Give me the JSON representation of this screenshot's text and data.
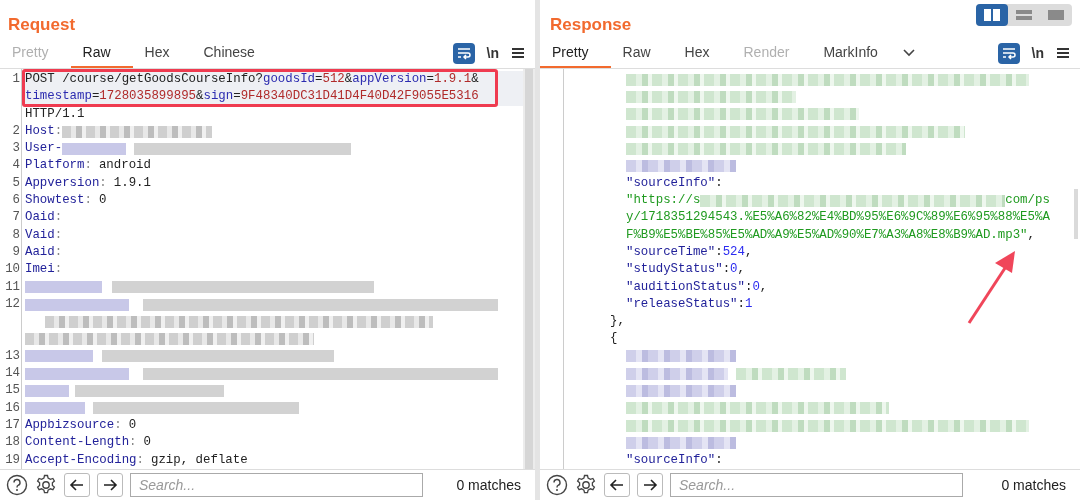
{
  "request": {
    "title": "Request",
    "tabs": [
      {
        "label": "Pretty",
        "selected": false,
        "disabled": true
      },
      {
        "label": "Raw",
        "selected": true,
        "disabled": false
      },
      {
        "label": "Hex",
        "selected": false,
        "disabled": false
      },
      {
        "label": "Chinese",
        "selected": false,
        "disabled": false
      }
    ],
    "toolbar": {
      "wrap_on": true,
      "newline_label": "\\n"
    },
    "lines": [
      {
        "number": "1",
        "kind": "request",
        "highlighted": true,
        "rows": [
          {
            "segments": [
              {
                "kind": "plain",
                "text": "POST /course/getGoodsCourseInfo?"
              },
              {
                "kind": "key",
                "text": "goodsId"
              },
              {
                "kind": "plain",
                "text": "="
              },
              {
                "kind": "value",
                "text": "512"
              },
              {
                "kind": "plain",
                "text": "&"
              },
              {
                "kind": "key",
                "text": "appVersion"
              },
              {
                "kind": "plain",
                "text": "="
              },
              {
                "kind": "value",
                "text": "1.9.1"
              },
              {
                "kind": "plain",
                "text": "&"
              }
            ]
          },
          {
            "segments": [
              {
                "kind": "key",
                "text": "timestamp"
              },
              {
                "kind": "plain",
                "text": "="
              },
              {
                "kind": "value",
                "text": "1728035899895"
              },
              {
                "kind": "plain",
                "text": "&"
              },
              {
                "kind": "key",
                "text": "sign"
              },
              {
                "kind": "plain",
                "text": "="
              },
              {
                "kind": "value",
                "text": "9F48340DC31D41D4F40D42F9055E5316"
              }
            ]
          },
          {
            "segments": [
              {
                "kind": "plain",
                "text": "HTTP/1.1"
              }
            ]
          }
        ]
      },
      {
        "number": "2",
        "kind": "redacted-header",
        "name": "Host",
        "sep": ":"
      },
      {
        "number": "3",
        "kind": "partial",
        "name": "User-"
      },
      {
        "number": "4",
        "kind": "header",
        "name": "Platform",
        "sep": ":",
        "value": "android"
      },
      {
        "number": "5",
        "kind": "header",
        "name": "Appversion",
        "sep": ":",
        "value": "1.9.1"
      },
      {
        "number": "6",
        "kind": "header",
        "name": "Showtest",
        "sep": ":",
        "value": "0"
      },
      {
        "number": "7",
        "kind": "header",
        "name": "Oaid",
        "sep": ":"
      },
      {
        "number": "8",
        "kind": "header",
        "name": "Vaid",
        "sep": ":"
      },
      {
        "number": "9",
        "kind": "header",
        "name": "Aaid",
        "sep": ":"
      },
      {
        "number": "10",
        "kind": "header",
        "name": "Imei",
        "sep": ":"
      },
      {
        "number": "11",
        "kind": "redacted"
      },
      {
        "number": "12",
        "kind": "redacted-wrapped"
      },
      {
        "number": "13",
        "kind": "redacted"
      },
      {
        "number": "14",
        "kind": "redacted"
      },
      {
        "number": "15",
        "kind": "redacted"
      },
      {
        "number": "16",
        "kind": "redacted"
      },
      {
        "number": "17",
        "kind": "header",
        "name": "Appbizsource",
        "sep": ":",
        "value": "0"
      },
      {
        "number": "18",
        "kind": "header",
        "name": "Content-Length",
        "sep": ":",
        "value": "0"
      },
      {
        "number": "19",
        "kind": "header",
        "name": "Accept-Encoding",
        "sep": ":",
        "value": "gzip, deflate"
      }
    ],
    "search": {
      "placeholder": "Search...",
      "matches": "0 matches"
    }
  },
  "response": {
    "title": "Response",
    "view_modes": [
      {
        "selected": true
      },
      {
        "selected": false
      },
      {
        "selected": false
      }
    ],
    "tabs": [
      {
        "label": "Pretty",
        "selected": true,
        "disabled": false
      },
      {
        "label": "Raw",
        "selected": false,
        "disabled": false
      },
      {
        "label": "Hex",
        "selected": false,
        "disabled": false
      },
      {
        "label": "Render",
        "selected": false,
        "disabled": true
      },
      {
        "label": "MarkInfo",
        "selected": false,
        "disabled": false
      }
    ],
    "toolbar": {
      "wrap_on": true,
      "newline_label": "\\n"
    },
    "rows": [
      {
        "kind": "redacted-string"
      },
      {
        "kind": "redacted-string"
      },
      {
        "kind": "redacted-string"
      },
      {
        "kind": "redacted-string"
      },
      {
        "kind": "redacted-string"
      },
      {
        "kind": "redacted-key"
      },
      {
        "kind": "pair",
        "key": "\"sourceInfo\"",
        "sep": ":"
      },
      {
        "kind": "url-start",
        "text": "\"https://s",
        "after": "com/ps"
      },
      {
        "kind": "string",
        "text": "y/1718351294543.%E5%A6%82%E4%BD%95%E6%9C%89%E6%95%88%E5%A"
      },
      {
        "kind": "string",
        "text": "F%B9%E5%BE%85%E5%AD%A9%E5%AD%90%E7%A3%A8%E8%B9%AD.mp3\"",
        "trail": ","
      },
      {
        "kind": "pair",
        "key": "\"sourceTime\"",
        "sep": ":",
        "value": "524",
        "trail": ","
      },
      {
        "kind": "pair",
        "key": "\"studyStatus\"",
        "sep": ":",
        "value": "0",
        "trail": ","
      },
      {
        "kind": "pair",
        "key": "\"auditionStatus\"",
        "sep": ":",
        "value": "0",
        "trail": ","
      },
      {
        "kind": "pair",
        "key": "\"releaseStatus\"",
        "sep": ":",
        "value": "1"
      },
      {
        "kind": "brace",
        "text": "},"
      },
      {
        "kind": "brace",
        "text": "{"
      },
      {
        "kind": "redacted-key"
      },
      {
        "kind": "redacted-pair"
      },
      {
        "kind": "redacted-key"
      },
      {
        "kind": "redacted-string"
      },
      {
        "kind": "redacted-string"
      },
      {
        "kind": "redacted-key"
      },
      {
        "kind": "pair",
        "key": "\"sourceInfo\"",
        "sep": ":"
      }
    ],
    "search": {
      "placeholder": "Search...",
      "matches": "0 matches"
    }
  }
}
